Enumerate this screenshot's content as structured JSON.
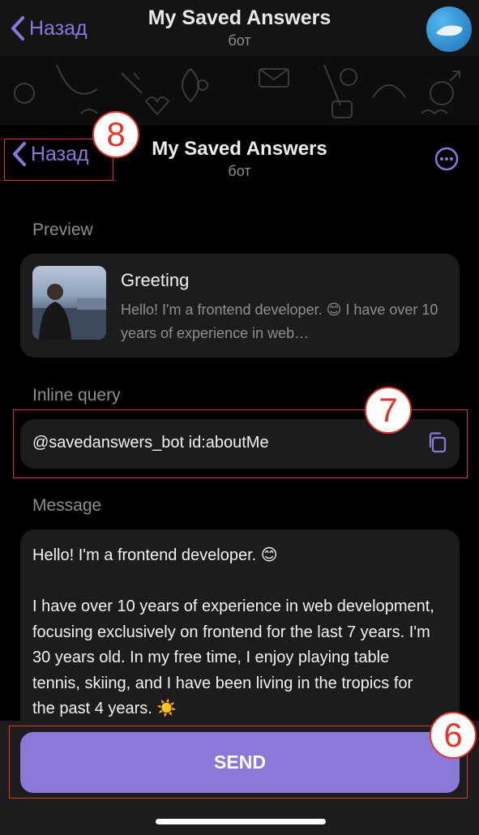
{
  "top_header": {
    "back_label": "Назад",
    "title": "My Saved Answers",
    "subtitle": "бот"
  },
  "sheet_header": {
    "back_label": "Назад",
    "title": "My Saved Answers",
    "subtitle": "бот"
  },
  "preview": {
    "section_label": "Preview",
    "title": "Greeting",
    "text": "Hello! I'm a frontend developer. 😊 I have over 10 years of experience in web…"
  },
  "inline_query": {
    "section_label": "Inline query",
    "value": "@savedanswers_bot id:aboutMe"
  },
  "message": {
    "section_label": "Message",
    "text": "Hello! I'm a frontend developer. 😊\n\nI have over 10 years of experience in web development, focusing exclusively on frontend for the last 7 years. I'm 30 years old. In my free time, I enjoy playing table tennis, skiing, and I have been living in the tropics for the past 4 years. ☀️"
  },
  "send_button": {
    "label": "SEND"
  },
  "annotations": {
    "back": "8",
    "query": "7",
    "send": "6"
  },
  "colors": {
    "accent": "#8c78d6",
    "marker": "#e3362b",
    "card": "#1c1c1e"
  }
}
